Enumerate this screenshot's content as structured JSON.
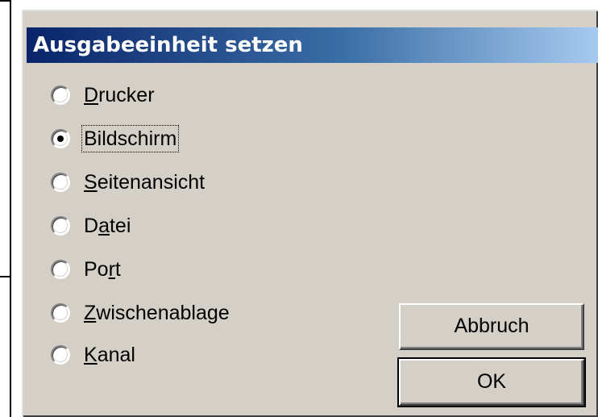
{
  "dialog": {
    "title": "Ausgabeeinheit setzen",
    "options": [
      {
        "label_pre": "",
        "mnemonic": "D",
        "label_post": "rucker",
        "checked": false,
        "focused": false
      },
      {
        "label_pre": "",
        "mnemonic": "",
        "label_post": "Bildschirm",
        "checked": true,
        "focused": true
      },
      {
        "label_pre": "",
        "mnemonic": "S",
        "label_post": "eitenansicht",
        "checked": false,
        "focused": false
      },
      {
        "label_pre": "D",
        "mnemonic": "a",
        "label_post": "tei",
        "checked": false,
        "focused": false
      },
      {
        "label_pre": "Po",
        "mnemonic": "r",
        "label_post": "t",
        "checked": false,
        "focused": false
      },
      {
        "label_pre": "",
        "mnemonic": "Z",
        "label_post": "wischenablage",
        "checked": false,
        "focused": false
      },
      {
        "label_pre": "",
        "mnemonic": "K",
        "label_post": "anal",
        "checked": false,
        "focused": false
      }
    ],
    "buttons": {
      "cancel": "Abbruch",
      "ok": "OK"
    }
  },
  "colors": {
    "dialog_face": "#d4d0c8",
    "title_gradient_start": "#0a246a",
    "title_gradient_end": "#a6caf0",
    "title_text": "#ffffff"
  }
}
